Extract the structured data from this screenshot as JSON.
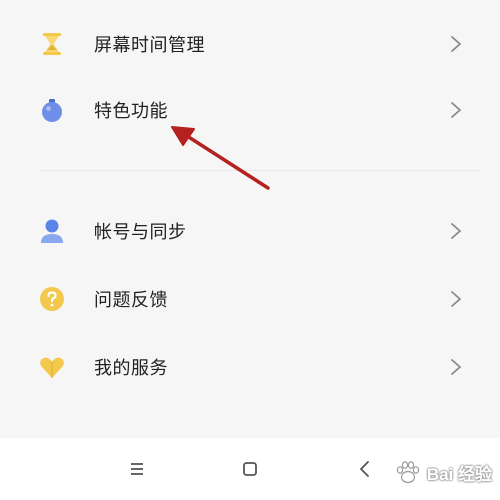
{
  "settings": {
    "group1": [
      {
        "label": "屏幕时间管理",
        "icon": "hourglass-icon",
        "icon_color": "#f2c94c"
      },
      {
        "label": "特色功能",
        "icon": "bomb-icon",
        "icon_color": "#6f8ee8"
      }
    ],
    "group2": [
      {
        "label": "帐号与同步",
        "icon": "user-icon",
        "icon_color": "#5a84e8"
      },
      {
        "label": "问题反馈",
        "icon": "question-icon",
        "icon_color": "#f2c94c"
      },
      {
        "label": "我的服务",
        "icon": "heart-icon",
        "icon_color": "#f2c94c"
      }
    ]
  },
  "annotation": {
    "arrow_color": "#b3221f"
  },
  "navbar": {
    "menu_icon": "menu-icon",
    "home_icon": "square-icon",
    "back_icon": "back-icon"
  },
  "watermark": {
    "text": "Bai 经验"
  }
}
